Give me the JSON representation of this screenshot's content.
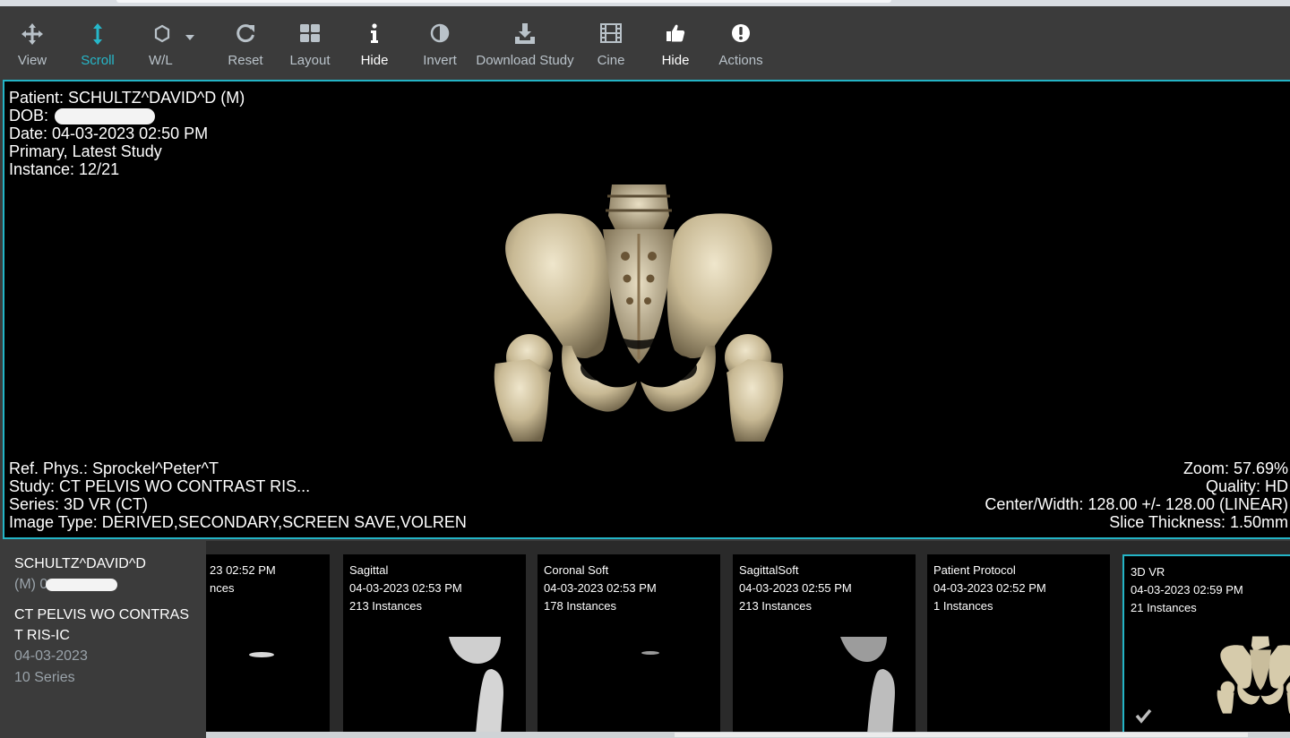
{
  "toolbar": {
    "view": "View",
    "scroll": "Scroll",
    "wl": "W/L",
    "reset": "Reset",
    "layout": "Layout",
    "hide_info": "Hide",
    "invert": "Invert",
    "download": "Download Study",
    "cine": "Cine",
    "hide_thumbs": "Hide",
    "actions": "Actions"
  },
  "viewport": {
    "patient": "Patient: SCHULTZ^DAVID^D (M)",
    "dob_label": "DOB:",
    "date": "Date: 04-03-2023 02:50 PM",
    "primary": "Primary, Latest Study",
    "instance": "Instance: 12/21",
    "ref_phys": "Ref. Phys.: Sprockel^Peter^T",
    "study": "Study: CT PELVIS WO CONTRAST RIS...",
    "series": "Series: 3D VR (CT)",
    "image_type": "Image Type: DERIVED,SECONDARY,SCREEN SAVE,VOLREN",
    "zoom": "Zoom: 57.69%",
    "quality": "Quality: HD",
    "center_width": "Center/Width: 128.00 +/- 128.00 (LINEAR)",
    "slice": "Slice Thickness: 1.50mm"
  },
  "study_info": {
    "patient_name": "SCHULTZ^DAVID^D",
    "sex_dob": "(M) 0",
    "study_line1": "CT PELVIS WO CONTRAS",
    "study_line2": "T RIS-IC",
    "date": "04-03-2023",
    "series_count": "10 Series"
  },
  "thumbnails": [
    {
      "title": "",
      "date": "23 02:52 PM",
      "instances": "nces"
    },
    {
      "title": "Sagittal",
      "date": "04-03-2023 02:53 PM",
      "instances": "213 Instances"
    },
    {
      "title": "Coronal Soft",
      "date": "04-03-2023 02:53 PM",
      "instances": "178 Instances"
    },
    {
      "title": "SagittalSoft",
      "date": "04-03-2023 02:55 PM",
      "instances": "213 Instances"
    },
    {
      "title": "Patient Protocol",
      "date": "04-03-2023 02:52 PM",
      "instances": "1 Instances"
    },
    {
      "title": "3D VR",
      "date": "04-03-2023 02:59 PM",
      "instances": "21 Instances"
    }
  ],
  "colors": {
    "accent": "#24b4c6",
    "toolbar_bg": "#3b3b3b",
    "viewport_bg": "#000000"
  }
}
